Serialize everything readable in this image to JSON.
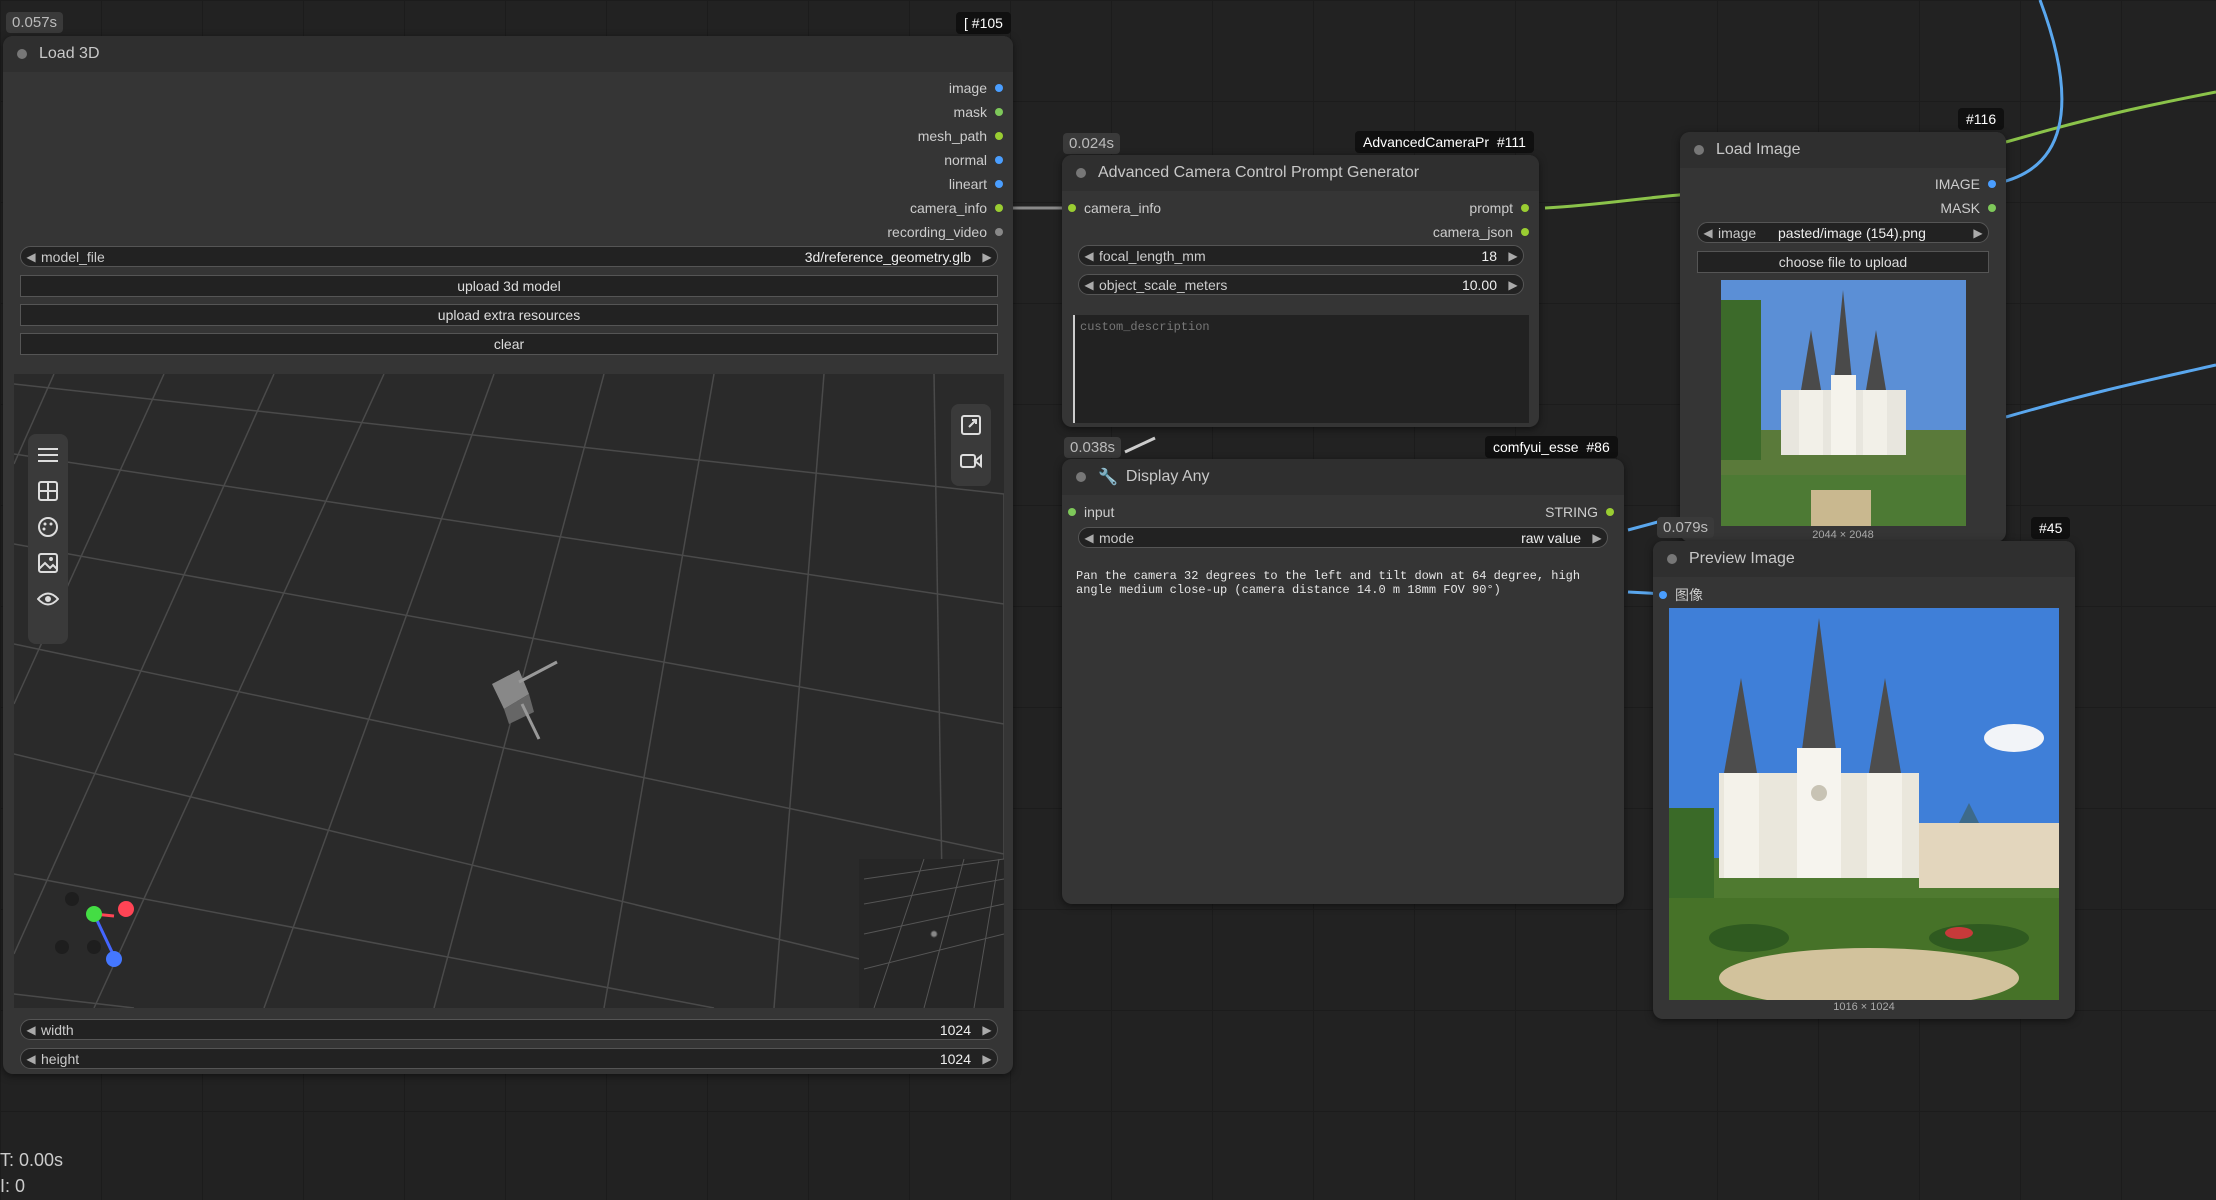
{
  "stats": {
    "time": "T: 0.00s",
    "iterations": "I: 0"
  },
  "load3d": {
    "timing": "0.057s",
    "badge": "[ #105",
    "title": "Load 3D",
    "outputs": [
      "image",
      "mask",
      "mesh_path",
      "normal",
      "lineart",
      "camera_info",
      "recording_video"
    ],
    "model_file_label": "model_file",
    "model_file_value": "3d/reference_geometry.glb",
    "upload_model": "upload 3d model",
    "upload_resources": "upload extra resources",
    "clear": "clear",
    "width_label": "width",
    "width_value": "1024",
    "height_label": "height",
    "height_value": "1024"
  },
  "camera": {
    "timing": "0.024s",
    "badge_name": "AdvancedCameraPr",
    "badge_id": "#111",
    "title": "Advanced Camera Control Prompt Generator",
    "input": "camera_info",
    "outputs": [
      "prompt",
      "camera_json"
    ],
    "focal_label": "focal_length_mm",
    "focal_value": "18",
    "scale_label": "object_scale_meters",
    "scale_value": "10.00",
    "desc_placeholder": "custom_description"
  },
  "display": {
    "timing": "0.038s",
    "badge_name": "comfyui_esse",
    "badge_id": "#86",
    "title": "Display Any",
    "input": "input",
    "output": "STRING",
    "mode_label": "mode",
    "mode_value": "raw value",
    "text": "Pan the camera 32 degrees to the left and tilt down at 64 degree, high angle medium close-up (camera distance 14.0 m 18mm FOV 90°)"
  },
  "loadimage": {
    "badge": "#116",
    "title": "Load Image",
    "outputs": [
      "IMAGE",
      "MASK"
    ],
    "image_label": "image",
    "image_value": "pasted/image (154).png",
    "choose": "choose file to upload",
    "dims": "2044 × 2048"
  },
  "preview": {
    "timing": "0.079s",
    "badge": "#45",
    "title": "Preview Image",
    "input": "图像",
    "dims": "1016 × 1024"
  },
  "colors": {
    "image": "#4a9eff",
    "mask": "#7ec85a",
    "string": "#9acd32",
    "link_green": "#8bc34a",
    "link_blue": "#5aa7ee"
  }
}
